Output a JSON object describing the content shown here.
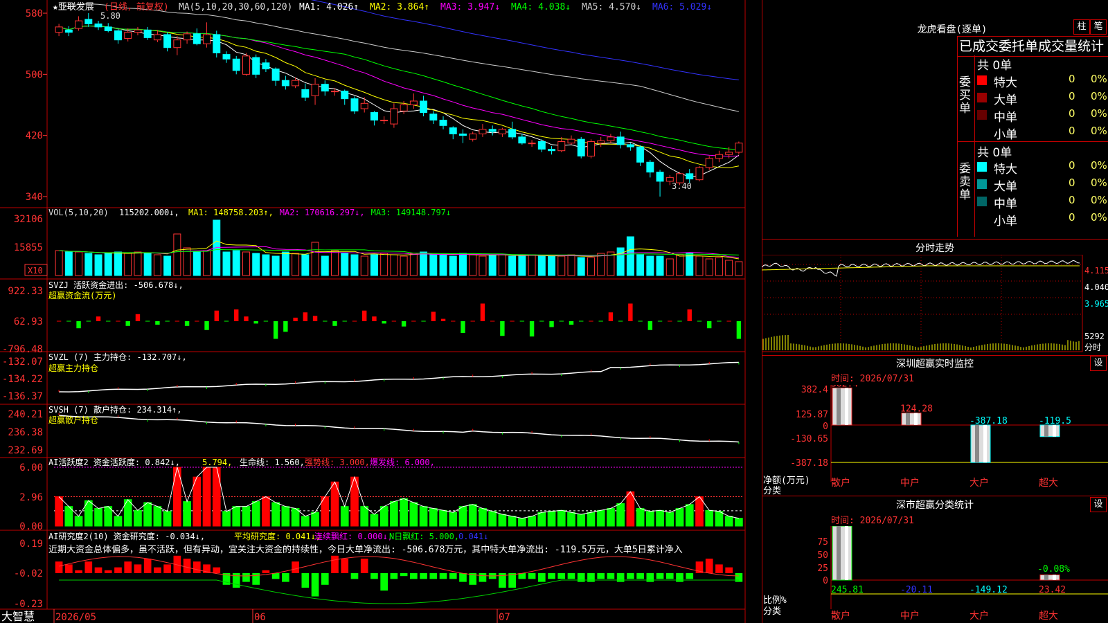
{
  "main": {
    "stock_label": "★亚联发展",
    "period_label": "(日线，前复权)",
    "ma_header": "MA(5,10,20,30,60,120)",
    "ma_items": [
      {
        "label": "MA1: 4.026↑",
        "color": "#ffffff"
      },
      {
        "label": "MA2: 3.864↑",
        "color": "#ffff00"
      },
      {
        "label": "MA3: 3.947↓",
        "color": "#ff00ff"
      },
      {
        "label": "MA4: 4.038↓",
        "color": "#00ff00"
      },
      {
        "label": "MA5: 4.570↓",
        "color": "#cccccc"
      },
      {
        "label": "MA6: 5.029↓",
        "color": "#3333ff"
      }
    ],
    "y_ticks": [
      "580",
      "500",
      "420",
      "340"
    ],
    "high_label": "5.80",
    "low_label": "3.40",
    "candles": [
      {
        "o": 5.55,
        "c": 5.62,
        "h": 5.66,
        "l": 5.5
      },
      {
        "o": 5.58,
        "c": 5.55,
        "h": 5.63,
        "l": 5.5
      },
      {
        "o": 5.6,
        "c": 5.7,
        "h": 5.76,
        "l": 5.57
      },
      {
        "o": 5.72,
        "c": 5.66,
        "h": 5.8,
        "l": 5.62
      },
      {
        "o": 5.66,
        "c": 5.62,
        "h": 5.7,
        "l": 5.58
      },
      {
        "o": 5.62,
        "c": 5.57,
        "h": 5.67,
        "l": 5.55
      },
      {
        "o": 5.57,
        "c": 5.45,
        "h": 5.59,
        "l": 5.4
      },
      {
        "o": 5.47,
        "c": 5.55,
        "h": 5.6,
        "l": 5.43
      },
      {
        "o": 5.55,
        "c": 5.58,
        "h": 5.62,
        "l": 5.51
      },
      {
        "o": 5.58,
        "c": 5.48,
        "h": 5.62,
        "l": 5.45
      },
      {
        "o": 5.45,
        "c": 5.52,
        "h": 5.58,
        "l": 5.42
      },
      {
        "o": 5.52,
        "c": 5.35,
        "h": 5.55,
        "l": 5.3
      },
      {
        "o": 5.35,
        "c": 5.45,
        "h": 5.5,
        "l": 5.25
      },
      {
        "o": 5.45,
        "c": 5.53,
        "h": 5.56,
        "l": 5.4
      },
      {
        "o": 5.53,
        "c": 5.4,
        "h": 5.6,
        "l": 5.38
      },
      {
        "o": 5.4,
        "c": 5.52,
        "h": 5.68,
        "l": 5.35
      },
      {
        "o": 5.52,
        "c": 5.28,
        "h": 5.57,
        "l": 5.22
      },
      {
        "o": 5.26,
        "c": 5.2,
        "h": 5.3,
        "l": 5.15
      },
      {
        "o": 5.2,
        "c": 5.05,
        "h": 5.24,
        "l": 5.0
      },
      {
        "o": 5.0,
        "c": 5.24,
        "h": 5.28,
        "l": 4.98
      },
      {
        "o": 5.22,
        "c": 5.0,
        "h": 5.26,
        "l": 4.95
      },
      {
        "o": 5.15,
        "c": 5.07,
        "h": 5.2,
        "l": 5.03
      },
      {
        "o": 5.07,
        "c": 4.92,
        "h": 5.09,
        "l": 4.85
      },
      {
        "o": 4.92,
        "c": 4.85,
        "h": 4.98,
        "l": 4.8
      },
      {
        "o": 4.85,
        "c": 4.92,
        "h": 4.96,
        "l": 4.82
      },
      {
        "o": 4.8,
        "c": 4.7,
        "h": 4.88,
        "l": 4.65
      },
      {
        "o": 4.72,
        "c": 4.87,
        "h": 4.95,
        "l": 4.6
      },
      {
        "o": 4.87,
        "c": 4.78,
        "h": 4.92,
        "l": 4.72
      },
      {
        "o": 4.78,
        "c": 4.78,
        "h": 4.82,
        "l": 4.72
      },
      {
        "o": 4.78,
        "c": 4.68,
        "h": 4.8,
        "l": 4.6
      },
      {
        "o": 4.68,
        "c": 4.52,
        "h": 4.71,
        "l": 4.48
      },
      {
        "o": 4.55,
        "c": 4.62,
        "h": 4.7,
        "l": 4.5
      },
      {
        "o": 4.5,
        "c": 4.4,
        "h": 4.52,
        "l": 4.33
      },
      {
        "o": 4.4,
        "c": 4.4,
        "h": 4.45,
        "l": 4.35
      },
      {
        "o": 4.35,
        "c": 4.55,
        "h": 4.62,
        "l": 4.3
      },
      {
        "o": 4.52,
        "c": 4.6,
        "h": 4.65,
        "l": 4.48
      },
      {
        "o": 4.6,
        "c": 4.65,
        "h": 4.75,
        "l": 4.55
      },
      {
        "o": 4.65,
        "c": 4.5,
        "h": 4.72,
        "l": 4.45
      },
      {
        "o": 4.48,
        "c": 4.4,
        "h": 4.52,
        "l": 4.35
      },
      {
        "o": 4.4,
        "c": 4.33,
        "h": 4.45,
        "l": 4.28
      },
      {
        "o": 4.3,
        "c": 4.22,
        "h": 4.32,
        "l": 4.15
      },
      {
        "o": 4.22,
        "c": 4.2,
        "h": 4.28,
        "l": 4.1
      },
      {
        "o": 4.15,
        "c": 4.22,
        "h": 4.25,
        "l": 4.12
      },
      {
        "o": 4.22,
        "c": 4.28,
        "h": 4.35,
        "l": 4.18
      },
      {
        "o": 4.28,
        "c": 4.25,
        "h": 4.33,
        "l": 4.2
      },
      {
        "o": 4.22,
        "c": 4.28,
        "h": 4.3,
        "l": 4.18
      },
      {
        "o": 4.28,
        "c": 4.18,
        "h": 4.38,
        "l": 4.15
      },
      {
        "o": 4.18,
        "c": 4.1,
        "h": 4.22,
        "l": 4.08
      },
      {
        "o": 4.1,
        "c": 4.1,
        "h": 4.14,
        "l": 4.05
      },
      {
        "o": 4.12,
        "c": 4.02,
        "h": 4.15,
        "l": 3.98
      },
      {
        "o": 4.02,
        "c": 4.0,
        "h": 4.06,
        "l": 3.95
      },
      {
        "o": 4.0,
        "c": 4.12,
        "h": 4.18,
        "l": 3.98
      },
      {
        "o": 4.1,
        "c": 4.15,
        "h": 4.2,
        "l": 4.08
      },
      {
        "o": 4.15,
        "c": 3.93,
        "h": 4.18,
        "l": 3.9
      },
      {
        "o": 3.93,
        "c": 4.12,
        "h": 4.15,
        "l": 3.9
      },
      {
        "o": 4.1,
        "c": 4.13,
        "h": 4.18,
        "l": 4.05
      },
      {
        "o": 4.13,
        "c": 4.18,
        "h": 4.22,
        "l": 4.1
      },
      {
        "o": 4.18,
        "c": 4.08,
        "h": 4.25,
        "l": 4.03
      },
      {
        "o": 4.08,
        "c": 4.05,
        "h": 4.1,
        "l": 4.0
      },
      {
        "o": 4.05,
        "c": 3.85,
        "h": 4.07,
        "l": 3.8
      },
      {
        "o": 3.85,
        "c": 3.72,
        "h": 3.88,
        "l": 3.65
      },
      {
        "o": 3.72,
        "c": 3.6,
        "h": 3.75,
        "l": 3.4
      },
      {
        "o": 3.6,
        "c": 3.65,
        "h": 3.68,
        "l": 3.55
      },
      {
        "o": 3.58,
        "c": 3.7,
        "h": 3.72,
        "l": 3.55
      },
      {
        "o": 3.7,
        "c": 3.63,
        "h": 3.76,
        "l": 3.58
      },
      {
        "o": 3.62,
        "c": 3.78,
        "h": 3.8,
        "l": 3.6
      },
      {
        "o": 3.78,
        "c": 3.9,
        "h": 3.93,
        "l": 3.75
      },
      {
        "o": 3.9,
        "c": 3.95,
        "h": 4.0,
        "l": 3.85
      },
      {
        "o": 3.95,
        "c": 3.98,
        "h": 4.05,
        "l": 3.9
      },
      {
        "o": 3.98,
        "c": 4.1,
        "h": 4.12,
        "l": 3.95
      }
    ]
  },
  "volume": {
    "header_name": "VOL(5,10,20)",
    "header_value": "115202.000↓,",
    "ma_items": [
      {
        "label": "MA1: 148758.203↑,",
        "color": "#ffff00"
      },
      {
        "label": "MA2: 170616.297↓,",
        "color": "#ff00ff"
      },
      {
        "label": "MA3: 149148.797↓",
        "color": "#00ff00"
      }
    ],
    "y_ticks": [
      "32106",
      "15855"
    ],
    "unit_label": "X10",
    "bars": [
      18,
      17,
      17,
      16,
      15,
      16,
      17,
      16,
      17,
      16,
      15,
      14,
      30,
      20,
      17,
      18,
      40,
      17,
      18,
      17,
      16,
      15,
      14,
      17,
      16,
      15,
      24,
      14,
      18,
      16,
      15,
      14,
      15,
      16,
      15,
      14,
      16,
      17,
      15,
      15,
      14,
      16,
      15,
      14,
      15,
      15,
      14,
      14,
      15,
      14,
      14,
      14,
      15,
      13,
      13,
      16,
      17,
      20,
      28,
      15,
      14,
      14,
      12,
      15,
      16,
      14,
      12,
      13,
      11,
      10
    ]
  },
  "svzj": {
    "header": "SVZJ  活跃资金进出: -506.678↓,",
    "subtitle": "超赢资金流(万元)",
    "y_ticks": [
      "922.33",
      "62.93",
      "-796.48"
    ],
    "values": [
      0,
      0,
      -120,
      0,
      80,
      0,
      0,
      -80,
      120,
      0,
      -60,
      0,
      0,
      -80,
      0,
      -150,
      180,
      0,
      200,
      80,
      -40,
      0,
      -300,
      -180,
      60,
      150,
      90,
      0,
      -80,
      0,
      0,
      180,
      80,
      -40,
      0,
      -90,
      0,
      0,
      160,
      40,
      0,
      -200,
      0,
      300,
      0,
      -250,
      0,
      0,
      -260,
      0,
      -100,
      0,
      -60,
      0,
      0,
      0,
      150,
      0,
      300,
      0,
      -150,
      0,
      0,
      0,
      200,
      0,
      -120,
      0,
      0,
      -300
    ]
  },
  "svzl": {
    "header": "SVZL (7) 主力持仓: -132.707↓,",
    "subtitle": "超赢主力持仓",
    "y_ticks": [
      "-132.07",
      "-134.22",
      "-136.37"
    ]
  },
  "svsh": {
    "header": "SVSH (7) 散户持仓: 234.314↑,",
    "subtitle": "超赢散户持仓",
    "y_ticks": [
      "240.21",
      "236.38",
      "232.69"
    ]
  },
  "ai_active": {
    "header": "AI活跃度2 资金活跃度: 0.842↓,",
    "items": [
      {
        "label": "5.794,",
        "color": "#ffff00"
      },
      {
        "label": "生命线: 1.560,",
        "color": "#ffffff"
      },
      {
        "label": "强势线: 3.000,",
        "color": "#ff3333"
      },
      {
        "label": "爆发线: 6.000,",
        "color": "#ff00ff"
      }
    ],
    "y_ticks": [
      "6.00",
      "2.96",
      "0.00"
    ],
    "values": [
      3,
      2,
      1,
      2.6,
      1.8,
      2,
      1,
      2.7,
      1.6,
      2.4,
      2,
      1.5,
      6,
      2.5,
      5,
      6,
      6,
      1.5,
      2,
      2,
      2.5,
      3,
      2.4,
      2,
      1.8,
      1,
      1.4,
      3,
      4.5,
      2,
      5,
      2,
      1.2,
      2,
      2.5,
      2.8,
      2.4,
      2,
      1.8,
      1.6,
      1.4,
      2,
      2.2,
      1.8,
      1.5,
      1.2,
      1,
      0.8,
      1,
      1.4,
      1.5,
      1.6,
      1.4,
      1.2,
      1.4,
      1.6,
      1.8,
      2.3,
      3.5,
      1.8,
      1.5,
      1.6,
      1.4,
      1.8,
      2.2,
      3,
      1.6,
      1.5,
      1,
      0.8
    ]
  },
  "ai_research": {
    "header": "AI研究度2(10) 资金研究度: -0.034↓,",
    "items": [
      {
        "label": "平均研究度: 0.041↓,",
        "color": "#ffff00"
      },
      {
        "label": "连续飘红: 0.000↓,",
        "color": "#ff00ff"
      },
      {
        "label": "N日飘红: 5.000,",
        "color": "#00ff00"
      },
      {
        "label": "0.041↓",
        "color": "#3333ff"
      }
    ],
    "comment": "近期大资金总体偏多，虽不活跃，但有异动，宜关注大资金的持续性，今日大单净流出: -506.678万元，其中特大单净流出: -119.5万元，大单5日累计净入",
    "y_ticks": [
      "0.19",
      "-0.02",
      "-0.23"
    ],
    "values": [
      0.04,
      0.03,
      0.01,
      0.04,
      0.02,
      0.01,
      0.02,
      0.04,
      0.03,
      0.05,
      0.02,
      0.03,
      0.06,
      0.05,
      0.04,
      0.03,
      0.02,
      -0.04,
      -0.05,
      -0.03,
      -0.04,
      0.01,
      -0.02,
      -0.03,
      0.04,
      -0.05,
      -0.08,
      -0.04,
      0.06,
      0.05,
      -0.02,
      0.05,
      -0.02,
      -0.06,
      -0.02,
      -0.01,
      -0.02,
      -0.02,
      -0.02,
      -0.02,
      -0.02,
      -0.03,
      -0.04,
      -0.03,
      -0.02,
      -0.05,
      -0.05,
      -0.02,
      -0.02,
      -0.03,
      -0.02,
      -0.02,
      -0.02,
      -0.03,
      -0.03,
      -0.02,
      -0.02,
      -0.03,
      -0.02,
      -0.02,
      -0.03,
      -0.02,
      -0.02,
      -0.03,
      -0.02,
      0.04,
      0.05,
      0.03,
      0.02,
      -0.03
    ]
  },
  "x_axis": {
    "ticks": [
      "2026/05",
      "06",
      "07"
    ],
    "brand": "大智慧"
  },
  "right": {
    "lhb": {
      "title": "龙虎看盘(逐单)",
      "btn_zhu": "柱",
      "btn_bi": "笔",
      "tabs_header": "已成交委托单成交量统计",
      "buy": {
        "side_label": "委买单",
        "total": "共 0单",
        "rows": [
          {
            "name": "特大",
            "count": "0",
            "pct": "0%",
            "color": "#ff0000"
          },
          {
            "name": "大单",
            "count": "0",
            "pct": "0%",
            "color": "#990000"
          },
          {
            "name": "中单",
            "count": "0",
            "pct": "0%",
            "color": "#660000"
          },
          {
            "name": "小单",
            "count": "0",
            "pct": "0%",
            "color": "#000000"
          }
        ]
      },
      "sell": {
        "side_label": "委卖单",
        "total": "共 0单",
        "rows": [
          {
            "name": "特大",
            "count": "0",
            "pct": "0%",
            "color": "#00ffff"
          },
          {
            "name": "大单",
            "count": "0",
            "pct": "0%",
            "color": "#009999"
          },
          {
            "name": "中单",
            "count": "0",
            "pct": "0%",
            "color": "#006666"
          },
          {
            "name": "小单",
            "count": "0",
            "pct": "0%",
            "color": "#000000"
          }
        ]
      }
    },
    "intraday": {
      "title": "分时走势",
      "price_ticks": [
        "4.115",
        "4.040",
        "3.965"
      ],
      "vol_label": "5292",
      "vol_unit": "分时"
    },
    "sz_monitor": {
      "title": "深圳超赢实时监控",
      "settings_btn": "设",
      "time": "时间: 2026/07/31",
      "y_ticks": [
        "382.4",
        "125.87",
        "0",
        "-130.65",
        "-387.18"
      ],
      "y_unit": "净额(万元)",
      "y_unit2": "分类",
      "categories": [
        "散户",
        "中户",
        "大户",
        "超大"
      ],
      "values": [
        382.4,
        124.28,
        -387.18,
        -119.5
      ],
      "value_labels": [
        "382.4",
        "124.28",
        "-387.18",
        "-119.5"
      ]
    },
    "sz_class": {
      "title": "深市超赢分类统计",
      "settings_btn": "设",
      "time": "时间: 2026/07/31",
      "y_ticks": [
        "75",
        "50",
        "25",
        "0"
      ],
      "y_unit": "比例%",
      "y_unit2": "分类",
      "categories": [
        "散户",
        "中户",
        "大户",
        "超大"
      ],
      "values": [
        245.81,
        -20.11,
        -149.12,
        23.42
      ],
      "value_labels": [
        "245.81",
        "-20.11",
        "-149.12",
        "23.42"
      ],
      "extra_label": "-0.08%"
    }
  },
  "colors": {
    "up": "#ff3333",
    "down": "#00ffff",
    "frame": "#c00000",
    "inflow": "#ff0000",
    "outflow": "#00ff00"
  }
}
